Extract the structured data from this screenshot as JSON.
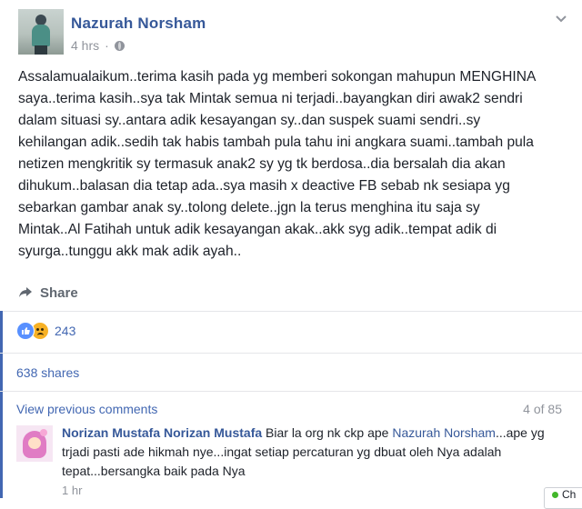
{
  "post": {
    "author": "Nazurah Norsham",
    "time": "4 hrs",
    "time_separator": "·",
    "privacy_icon": "globe-icon",
    "menu_icon": "chevron-down-icon",
    "text": "Assalamualaikum..terima kasih pada yg memberi sokongan mahupun MENGHINA\nsaya..terima kasih..sya tak Mintak semua ni terjadi..bayangkan diri awak2 sendri\ndalam situasi sy..antara adik kesayangan sy..dan suspek suami sendri..sy\nkehilangan adik..sedih tak habis tambah pula tahu ini angkara suami..tambah pula\nnetizen mengkritik sy termasuk anak2 sy yg tk berdosa..dia bersalah dia akan\ndihukum..balasan dia tetap ada..sya masih x deactive FB sebab nk sesiapa yg\nsebarkan gambar anak sy..tolong delete..jgn la terus menghina itu saja sy\nMintak..Al Fatihah untuk adik kesayangan akak..akk syg adik..tempat adik di\nsyurga..tunggu akk mak adik ayah..",
    "share_label": "Share"
  },
  "reactions": {
    "icons": [
      "like-icon",
      "sad-icon"
    ],
    "count": "243"
  },
  "shares": "638 shares",
  "comments": {
    "view_previous": "View previous comments",
    "page_count": "4 of 85",
    "items": [
      {
        "author": "Norizan Mustafa Norizan Mustafa",
        "pre_text": "Biar la org nk ckp ape",
        "mention": "Nazurah Norsham",
        "post_text": "...ape yg trjadi pasti ade hikmah nye...ingat setiap percaturan yg dbuat oleh Nya adalah tepat...bersangka baik pada Nya",
        "time": "1 hr"
      }
    ]
  },
  "chat": {
    "label": "Ch"
  },
  "colors": {
    "link": "#365899",
    "accent": "#4267b2",
    "muted": "#90949c",
    "text": "#1d2129"
  }
}
